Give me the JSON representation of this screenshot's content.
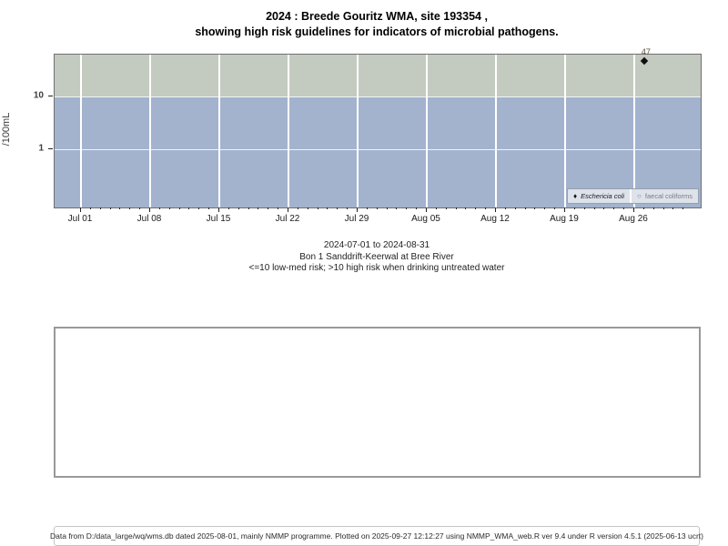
{
  "title": {
    "line1": "2024 : Breede Gouritz WMA, site 193354 ,",
    "line2": "showing high risk guidelines for indicators of microbial pathogens."
  },
  "chart_data": {
    "type": "scatter",
    "y_scale": "log",
    "ylabel": "/100mL",
    "y_ticks": [
      "10",
      "1"
    ],
    "x_ticks": [
      "Jul 01",
      "Jul 08",
      "Jul 15",
      "Jul 22",
      "Jul 29",
      "Aug 05",
      "Aug 12",
      "Aug 19",
      "Aug 26"
    ],
    "x_range": [
      "2024-07-01",
      "2024-08-31"
    ],
    "grid": "white weekly vertical lines, white horizontal lines at 1 and 10",
    "bands": [
      {
        "name": "high risk (>10)",
        "color": "#c3cbc0"
      },
      {
        "name": "low-med risk (<=10)",
        "color": "#a3b3ce"
      }
    ],
    "series": [
      {
        "name": "Eschericia coli",
        "symbol": "filled-diamond",
        "color": "#111111",
        "points": [
          {
            "date": "2024-08-27",
            "day_index": 57,
            "value": 47,
            "label": "47"
          }
        ]
      },
      {
        "name": "faecal coliforms",
        "symbol": "open-circle",
        "color": "#7d7d7d",
        "points": []
      }
    ],
    "legend": {
      "position": "bottom-right",
      "symbol_ecoli": "♦",
      "symbol_faecal": "○"
    }
  },
  "caption": {
    "line1": "2024-07-01 to 2024-08-31",
    "line2": "Bon 1 Sanddrift-Keerwal at Bree River",
    "line3": "<=10 low-med risk; >10 high risk when drinking untreated water"
  },
  "footer": {
    "text": "Data from D:/data_large/wq/wms.db dated 2025-08-01, mainly NMMP programme. Plotted on 2025-09-27 12:12:27 using NMMP_WMA_web.R ver 9.4 under R version 4.5.1 (2025-06-13 ucrt)"
  }
}
